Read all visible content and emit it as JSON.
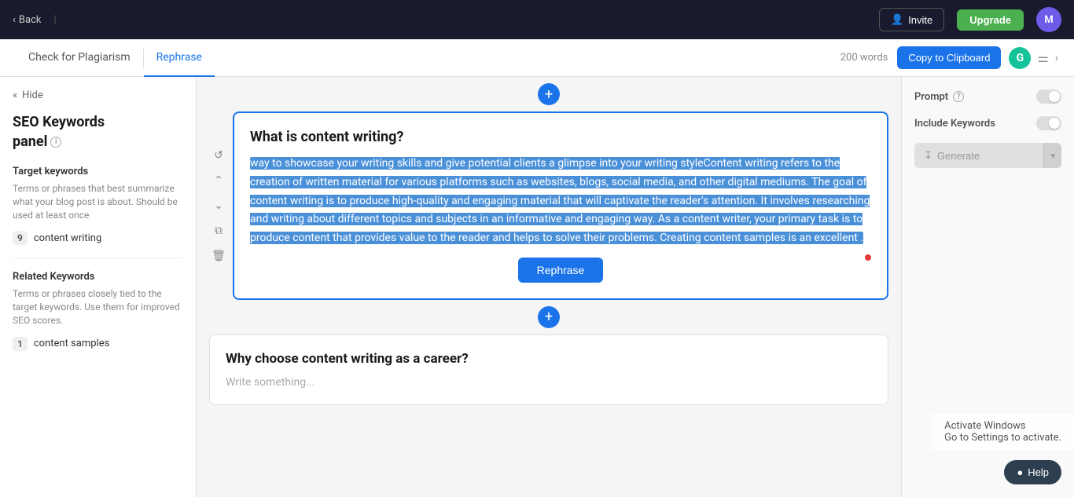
{
  "topNav": {
    "back_label": "Back",
    "divider": "|",
    "invite_label": "Invite",
    "upgrade_label": "Upgrade",
    "avatar_letter": "M"
  },
  "secondNav": {
    "links": [
      {
        "label": "Check for Plagiarism",
        "active": false
      },
      {
        "label": "Rephrase",
        "active": true
      }
    ],
    "word_count": "200 words",
    "copy_label": "Copy to Clipboard",
    "grammarly_letter": "G"
  },
  "sidebar": {
    "hide_label": "Hide",
    "title_line1": "SEO Keywords",
    "title_line2": "panel",
    "target_title": "Target keywords",
    "target_desc": "Terms or phrases that best summarize what your blog post is about. Should be used at least once",
    "target_keywords": [
      {
        "count": 9,
        "text": "content writing"
      }
    ],
    "related_title": "Related Keywords",
    "related_desc": "Terms or phrases closely tied to the target keywords. Use them for improved SEO scores.",
    "related_keywords": [
      {
        "count": 1,
        "text": "content samples"
      }
    ]
  },
  "contentBlock1": {
    "title": "What is content writing?",
    "highlighted_text": "way to showcase your writing skills and give potential clients a glimpse into your writing styleContent writing refers to the creation of written material for various platforms such as websites, blogs, social media, and other digital mediums. The goal of content writing is to produce high-quality and engaging material that will captivate the reader's attention. It involves researching and writing about different topics and subjects in an informative and engaging way. As a content writer, your primary task is to produce content that provides value to the reader and helps to solve their problems. Creating content samples is an excellent .",
    "rephrase_label": "Rephrase"
  },
  "contentBlock2": {
    "title": "Why choose content writing as a career?",
    "placeholder": "Write something..."
  },
  "rightPanel": {
    "prompt_label": "Prompt",
    "keywords_label": "Include Keywords",
    "generate_label": "Generate",
    "generate_icon": "↧"
  },
  "activateWindows": {
    "line1": "Activate Windows",
    "line2": "Go to Settings to activate."
  },
  "helpBtn": {
    "label": "Help"
  }
}
